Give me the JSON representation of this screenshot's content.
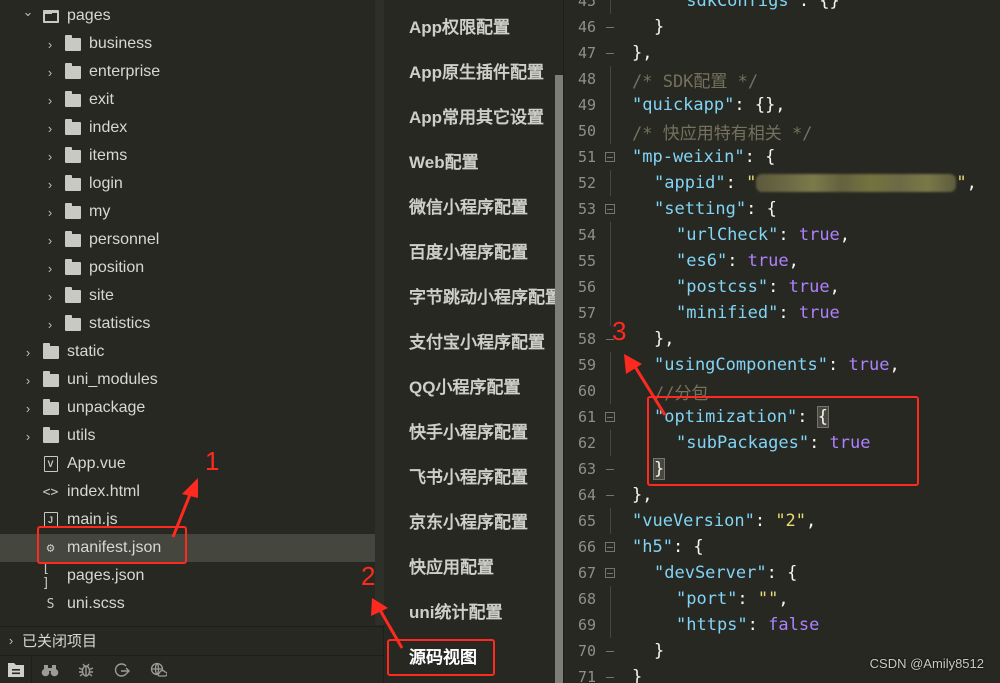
{
  "project_tree": {
    "items": [
      {
        "label": "pages",
        "type": "folder",
        "expanded": true,
        "depth": 1
      },
      {
        "label": "business",
        "type": "folder",
        "depth": 2
      },
      {
        "label": "enterprise",
        "type": "folder",
        "depth": 2
      },
      {
        "label": "exit",
        "type": "folder",
        "depth": 2
      },
      {
        "label": "index",
        "type": "folder",
        "depth": 2
      },
      {
        "label": "items",
        "type": "folder",
        "depth": 2
      },
      {
        "label": "login",
        "type": "folder",
        "depth": 2
      },
      {
        "label": "my",
        "type": "folder",
        "depth": 2
      },
      {
        "label": "personnel",
        "type": "folder",
        "depth": 2
      },
      {
        "label": "position",
        "type": "folder",
        "depth": 2
      },
      {
        "label": "site",
        "type": "folder",
        "depth": 2
      },
      {
        "label": "statistics",
        "type": "folder",
        "depth": 2
      },
      {
        "label": "static",
        "type": "folder",
        "depth": 1
      },
      {
        "label": "uni_modules",
        "type": "folder",
        "depth": 1
      },
      {
        "label": "unpackage",
        "type": "folder",
        "depth": 1
      },
      {
        "label": "utils",
        "type": "folder",
        "depth": 1
      },
      {
        "label": "App.vue",
        "type": "vue",
        "depth": 1,
        "icon_glyph": "V"
      },
      {
        "label": "index.html",
        "type": "html",
        "depth": 1,
        "icon_glyph": "<>"
      },
      {
        "label": "main.js",
        "type": "js",
        "depth": 1,
        "icon_glyph": "J"
      },
      {
        "label": "manifest.json",
        "type": "manifest",
        "depth": 1,
        "icon_glyph": "⚙",
        "selected": true
      },
      {
        "label": "pages.json",
        "type": "json",
        "depth": 1,
        "icon_glyph": "[ ]"
      },
      {
        "label": "uni.scss",
        "type": "scss",
        "depth": 1,
        "icon_glyph": "S"
      }
    ],
    "closed_projects_label": "已关闭项目"
  },
  "bottom_toolbar": {
    "icons": [
      "project-manager-icon",
      "search-binoculars-icon",
      "debug-bug-icon",
      "git-source-control-icon",
      "cloud-service-icon"
    ]
  },
  "settings_nav": {
    "items": [
      {
        "label": "App权限配置"
      },
      {
        "label": "App原生插件配置"
      },
      {
        "label": "App常用其它设置"
      },
      {
        "label": "Web配置"
      },
      {
        "label": "微信小程序配置"
      },
      {
        "label": "百度小程序配置"
      },
      {
        "label": "字节跳动小程序配置"
      },
      {
        "label": "支付宝小程序配置"
      },
      {
        "label": "QQ小程序配置"
      },
      {
        "label": "快手小程序配置"
      },
      {
        "label": "飞书小程序配置"
      },
      {
        "label": "京东小程序配置"
      },
      {
        "label": "快应用配置"
      },
      {
        "label": "uni统计配置"
      },
      {
        "label": "源码视图",
        "active": true
      }
    ]
  },
  "editor": {
    "lines": [
      {
        "n": "45",
        "fold": "line",
        "indent": 3,
        "html": "<span class='key'>\"sdkConfigs\"</span><span class='p'>: {}</span>"
      },
      {
        "n": "46",
        "fold": "end",
        "indent": 2,
        "html": "<span class='p'>}</span>"
      },
      {
        "n": "47",
        "fold": "end",
        "indent": 1,
        "html": "<span class='p'>},</span>"
      },
      {
        "n": "48",
        "fold": "line",
        "indent": 1,
        "html": "<span class='cmt'>/* SDK配置 */</span>"
      },
      {
        "n": "49",
        "fold": "line",
        "indent": 1,
        "html": "<span class='key'>\"quickapp\"</span><span class='p'>: {},</span>"
      },
      {
        "n": "50",
        "fold": "line",
        "indent": 1,
        "html": "<span class='cmt'>/* 快应用特有相关 */</span>"
      },
      {
        "n": "51",
        "fold": "box",
        "indent": 1,
        "html": "<span class='key'>\"mp-weixin\"</span><span class='p'>: {</span>"
      },
      {
        "n": "52",
        "fold": "line",
        "indent": 2,
        "html": "<span class='key'>\"appid\"</span><span class='p'>: </span><span class='str'>\"</span><span class='blur'></span><span class='str'>\"</span><span class='p'>,</span>"
      },
      {
        "n": "53",
        "fold": "box",
        "indent": 2,
        "html": "<span class='key'>\"setting\"</span><span class='p'>: {</span>"
      },
      {
        "n": "54",
        "fold": "line",
        "indent": 3,
        "html": "<span class='key'>\"urlCheck\"</span><span class='p'>: </span><span class='bool'>true</span><span class='p'>,</span>"
      },
      {
        "n": "55",
        "fold": "line",
        "indent": 3,
        "html": "<span class='key'>\"es6\"</span><span class='p'>: </span><span class='bool'>true</span><span class='p'>,</span>"
      },
      {
        "n": "56",
        "fold": "line",
        "indent": 3,
        "html": "<span class='key'>\"postcss\"</span><span class='p'>: </span><span class='bool'>true</span><span class='p'>,</span>"
      },
      {
        "n": "57",
        "fold": "line",
        "indent": 3,
        "html": "<span class='key'>\"minified\"</span><span class='p'>: </span><span class='bool'>true</span>"
      },
      {
        "n": "58",
        "fold": "end",
        "indent": 2,
        "html": "<span class='p'>},</span>"
      },
      {
        "n": "59",
        "fold": "line",
        "indent": 2,
        "html": "<span class='key'>\"usingComponents\"</span><span class='p'>: </span><span class='bool'>true</span><span class='p'>,</span>"
      },
      {
        "n": "60",
        "fold": "line",
        "indent": 2,
        "html": "<span class='cmt'>//分包</span>"
      },
      {
        "n": "61",
        "fold": "box",
        "indent": 2,
        "html": "<span class='key'>\"optimization\"</span><span class='p'>: </span><span class='p brace-hl'>{</span>"
      },
      {
        "n": "62",
        "fold": "line",
        "indent": 3,
        "html": "<span class='key'>\"subPackages\"</span><span class='p'>: </span><span class='bool'>true</span>"
      },
      {
        "n": "63",
        "fold": "end",
        "indent": 2,
        "html": "<span class='p brace-hl'>}</span>"
      },
      {
        "n": "64",
        "fold": "end",
        "indent": 1,
        "html": "<span class='p'>},</span>"
      },
      {
        "n": "65",
        "fold": "line",
        "indent": 1,
        "html": "<span class='key'>\"vueVersion\"</span><span class='p'>: </span><span class='str'>\"2\"</span><span class='p'>,</span>"
      },
      {
        "n": "66",
        "fold": "box",
        "indent": 1,
        "html": "<span class='key'>\"h5\"</span><span class='p'>: {</span>"
      },
      {
        "n": "67",
        "fold": "box",
        "indent": 2,
        "html": "<span class='key'>\"devServer\"</span><span class='p'>: {</span>"
      },
      {
        "n": "68",
        "fold": "line",
        "indent": 3,
        "html": "<span class='key'>\"port\"</span><span class='p'>: </span><span class='str'>\"\"</span><span class='p'>,</span>"
      },
      {
        "n": "69",
        "fold": "line",
        "indent": 3,
        "html": "<span class='key'>\"https\"</span><span class='p'>: </span><span class='bool'>false</span>"
      },
      {
        "n": "70",
        "fold": "end",
        "indent": 2,
        "html": "<span class='p'>}</span>"
      },
      {
        "n": "71",
        "fold": "end",
        "indent": 1,
        "html": "<span class='p'>}</span>"
      }
    ]
  },
  "annotations": {
    "step1": "1",
    "step2": "2",
    "step3": "3",
    "color": "#ff2a1f"
  },
  "watermark": "CSDN @Amily8512",
  "theme": {
    "background": "#272822",
    "selected_row": "#45463e",
    "key_color": "#81d4f5",
    "bool_color": "#ae81ff",
    "string_color": "#e6db74",
    "comment_color": "#75715e"
  }
}
